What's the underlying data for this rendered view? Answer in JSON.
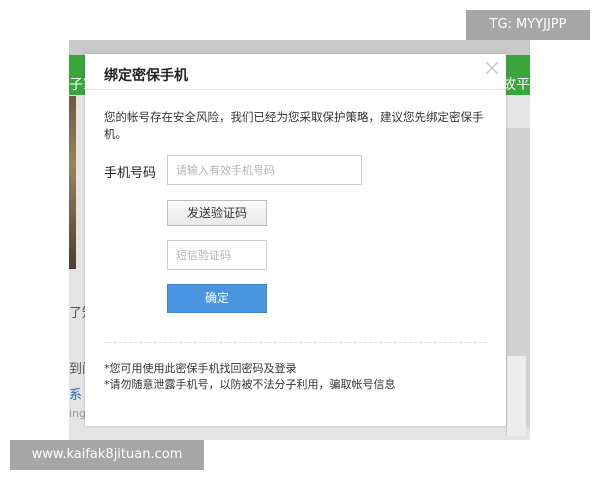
{
  "background_page": {
    "nav_left_text": "子家",
    "nav_right_text": "故平",
    "side_text_1": "了知",
    "side_text_2": "到问",
    "side_link": "系",
    "side_small": "ing",
    "header_color": "#3aa53a"
  },
  "dialog": {
    "title": "绑定密保手机",
    "close_icon": "close-icon",
    "notice": "您的帐号存在安全风险，我们已经为您采取保护策略，建议您先绑定密保手机。",
    "phone": {
      "label": "手机号码",
      "placeholder": "请输入有效手机号码",
      "value": ""
    },
    "send_code_label": "发送验证码",
    "sms_code": {
      "placeholder": "短信验证码",
      "value": ""
    },
    "confirm_label": "确定",
    "confirm_color": "#4a94e0",
    "notes": [
      "*您可用使用此密保手机找回密码及登录",
      "*请勿随意泄露手机号，以防被不法分子利用，骗取帐号信息"
    ]
  },
  "watermarks": {
    "top_right": "TG: MYYJJPP",
    "bottom_left": "www.kaifak8jituan.com"
  }
}
